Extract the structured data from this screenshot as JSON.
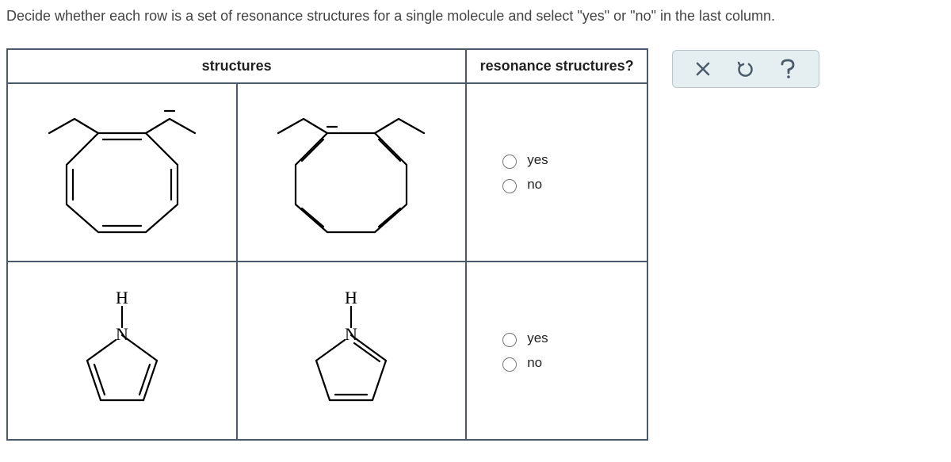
{
  "instruction": "Decide whether each row is a set of resonance structures for a single molecule and select \"yes\" or \"no\" in the last column.",
  "headers": {
    "structures": "structures",
    "resonance": "resonance structures?"
  },
  "options": {
    "yes": "yes",
    "no": "no"
  },
  "rows": [
    {
      "structure_a": "cyclooctatetraene-with-methyls-var1",
      "structure_b": "cyclooctatetraene-with-methyls-var2"
    },
    {
      "structure_a": "pyrrole-var1",
      "structure_b": "pyrrole-var2"
    }
  ],
  "toolbar": {
    "clear": "clear",
    "undo": "undo",
    "help": "help"
  }
}
